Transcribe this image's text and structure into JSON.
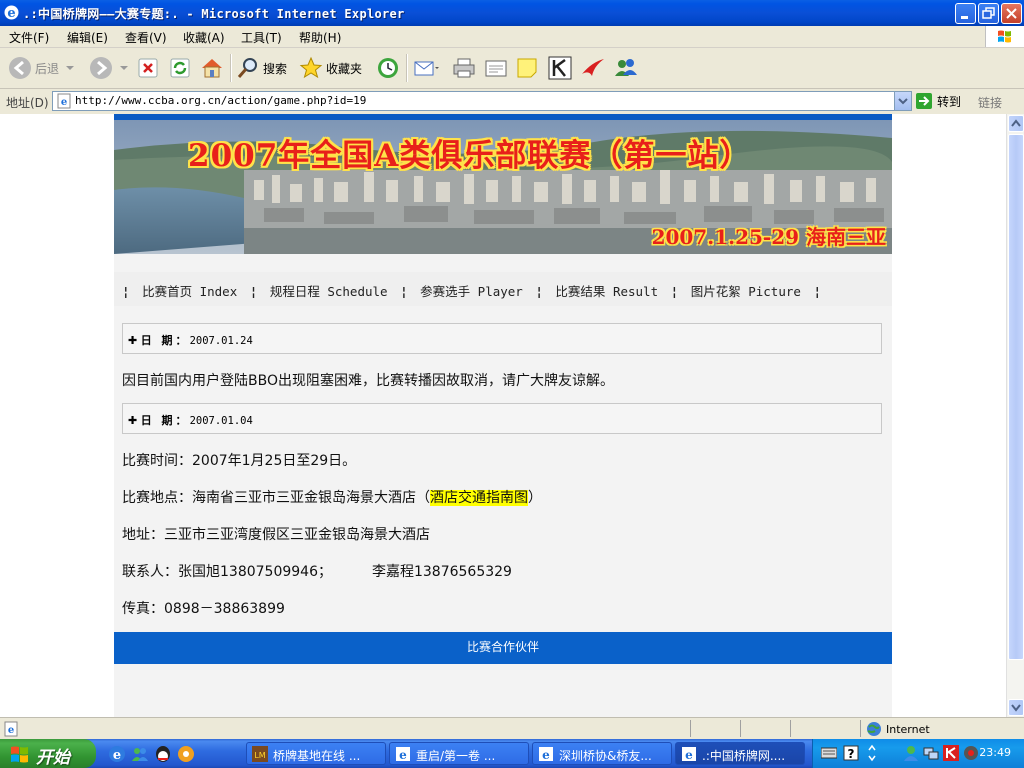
{
  "window": {
    "title": ".:中国桥牌网——大赛专题:. - Microsoft Internet Explorer"
  },
  "menu": [
    "文件(F)",
    "编辑(E)",
    "查看(V)",
    "收藏(A)",
    "工具(T)",
    "帮助(H)"
  ],
  "toolbar": {
    "back": "后退",
    "search": "搜索",
    "favorites": "收藏夹"
  },
  "address": {
    "label": "地址(D)",
    "url": "http://www.ccba.org.cn/action/game.php?id=19",
    "go": "转到",
    "links": "链接"
  },
  "banner": {
    "title": "2007年全国A类俱乐部联赛（第一站）",
    "date_place": "2007.1.25-29 海南三亚"
  },
  "nav": [
    {
      "label": "比赛首页 Index"
    },
    {
      "label": "规程日程 Schedule"
    },
    {
      "label": "参赛选手 Player"
    },
    {
      "label": "比赛结果 Result"
    },
    {
      "label": "图片花絮 Picture"
    }
  ],
  "news": [
    {
      "date_label": "日 期：",
      "date": "2007.01.24"
    },
    {
      "date_label": "日 期：",
      "date": "2007.01.04"
    }
  ],
  "notice": "因目前国内用户登陆BBO出现阻塞困难，比赛转播因故取消，请广大牌友谅解。",
  "details": {
    "time": "比赛时间：2007年1月25日至29日。",
    "venue_prefix": "比赛地点：海南省三亚市三亚金银岛海景大酒店（",
    "venue_link": "酒店交通指南图",
    "venue_suffix": "）",
    "address": "地址：三亚市三亚湾度假区三亚金银岛海景大酒店",
    "contact_1": "联系人：张国旭13807509946；",
    "contact_2": "李嘉程13876565329",
    "fax": "传真：0898－38863899"
  },
  "partners": "比赛合作伙伴",
  "status": {
    "zone": "Internet"
  },
  "taskbar": {
    "start": "开始",
    "tasks": [
      {
        "label": "桥牌基地在线 ..."
      },
      {
        "label": "重启/第一卷 ..."
      },
      {
        "label": "深圳桥协&桥友..."
      },
      {
        "label": ".:中国桥牌网...."
      }
    ],
    "clock": "23:49"
  },
  "colors": {
    "titlebar": "#0054E3",
    "page_blue": "#0A5BC3",
    "highlight": "#FFFF00",
    "banner_text": "#E8201A"
  }
}
